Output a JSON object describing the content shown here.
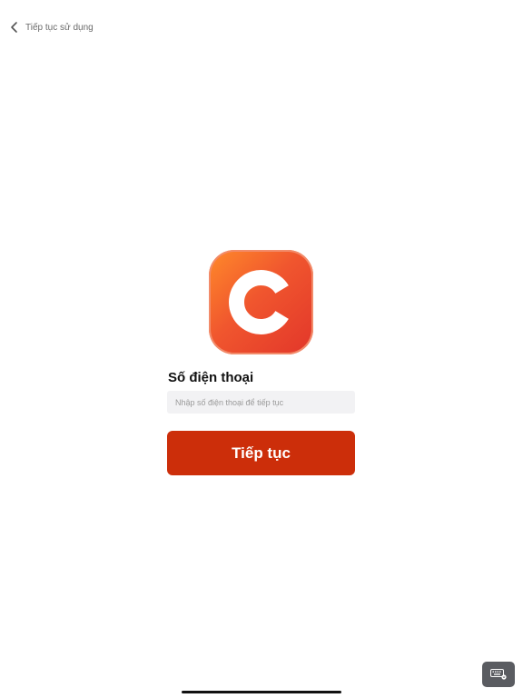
{
  "header": {
    "back_label": "Tiếp tục sử dụng",
    "back_icon": "chevron-left-icon"
  },
  "logo": {
    "letter": "C",
    "colors": {
      "gradient_start": "#ff8a2a",
      "gradient_end": "#e2362a",
      "letter": "#ffffff"
    }
  },
  "form": {
    "phone_label": "Số điện thoại",
    "phone_placeholder": "Nhập số điện thoại để tiếp tục",
    "phone_value": "",
    "submit_label": "Tiếp tục"
  },
  "colors": {
    "accent": "#cc2e0a",
    "input_bg": "#f2f2f4"
  },
  "system": {
    "keyboard_icon": "keyboard-icon"
  }
}
